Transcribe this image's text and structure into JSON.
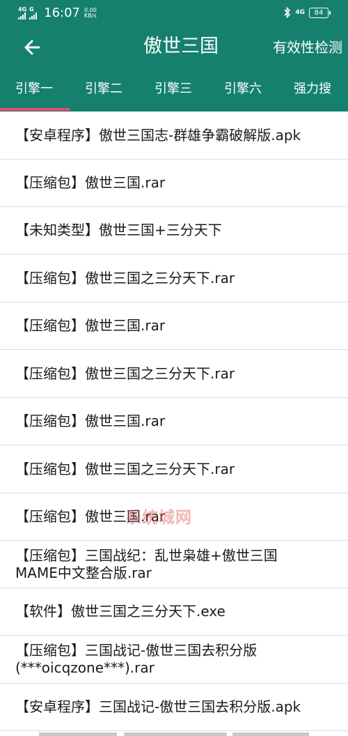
{
  "status_bar": {
    "network_1": "4G",
    "network_2": "G",
    "time": "16:07",
    "speed_value": "0.00",
    "speed_unit": "KB/s",
    "network_right": "4G",
    "battery": "84"
  },
  "app_bar": {
    "title": "傲世三国",
    "action": "有效性检测"
  },
  "tabs": [
    {
      "label": "引擎一",
      "selected": true
    },
    {
      "label": "引擎二",
      "selected": false
    },
    {
      "label": "引擎三",
      "selected": false
    },
    {
      "label": "引擎六",
      "selected": false
    },
    {
      "label": "强力搜",
      "selected": false
    }
  ],
  "results": [
    "【安卓程序】傲世三国志-群雄争霸破解版.apk",
    "【压缩包】傲世三国.rar",
    "【未知类型】傲世三国+三分天下",
    "【压缩包】傲世三国之三分天下.rar",
    "【压缩包】傲世三国.rar",
    "【压缩包】傲世三国之三分天下.rar",
    "【压缩包】傲世三国.rar",
    "【压缩包】傲世三国之三分天下.rar",
    "【压缩包】傲世三国.rar",
    "【压缩包】三国战纪：乱世枭雄+傲世三国\nMAME中文整合版.rar",
    "【软件】傲世三国之三分天下.exe",
    "【压缩包】三国战记-傲世三国去积分版\n(***oicqzone***).rar",
    "【安卓程序】三国战记-傲世三国去积分版.apk"
  ],
  "watermark": "系统城网",
  "colors": {
    "primary": "#16806f",
    "indicator": "#e64a72",
    "divider": "#dedede"
  }
}
